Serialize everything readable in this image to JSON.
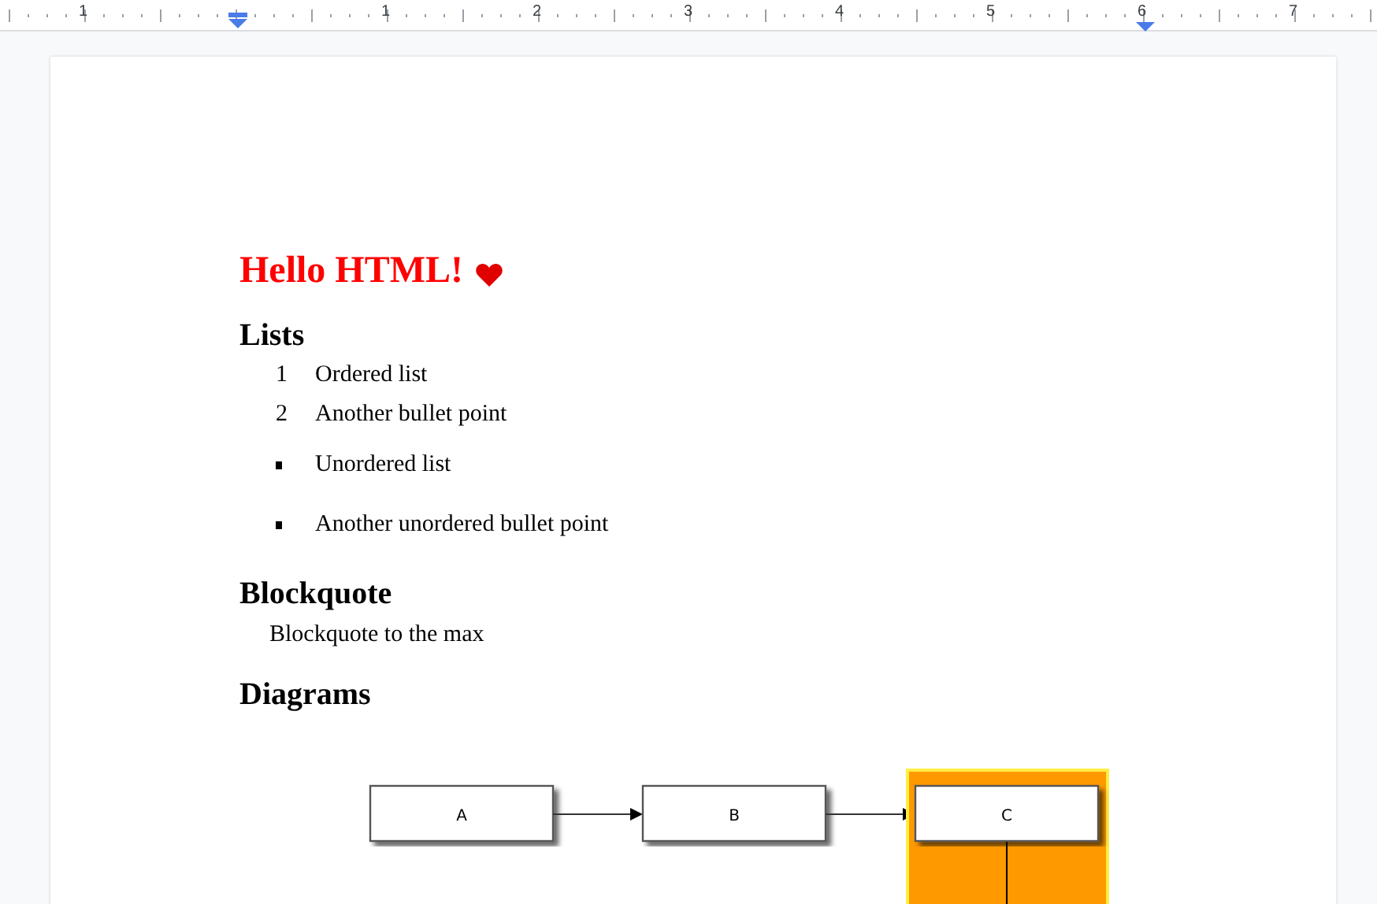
{
  "ruler": {
    "labels": [
      "1",
      "1",
      "2",
      "3",
      "4",
      "5",
      "6",
      "7"
    ]
  },
  "title": "Hello HTML!",
  "sections": [
    {
      "kind": "list",
      "heading": "Lists",
      "items": [
        {
          "kind": "ordered",
          "marker": "1",
          "text": "Ordered list"
        },
        {
          "kind": "ordered",
          "marker": "2",
          "text": "Another bullet point"
        },
        {
          "kind": "unordered",
          "text": "Unordered list"
        },
        {
          "kind": "unordered",
          "text": "Another unordered bullet point"
        }
      ]
    },
    {
      "kind": "quote",
      "heading": "Blockquote",
      "text": "Blockquote to the max"
    },
    {
      "kind": "diagram",
      "heading": "Diagrams",
      "nodes": [
        {
          "label": "A",
          "highlighted": false
        },
        {
          "label": "B",
          "highlighted": false
        },
        {
          "label": "C",
          "highlighted": true
        }
      ]
    }
  ]
}
